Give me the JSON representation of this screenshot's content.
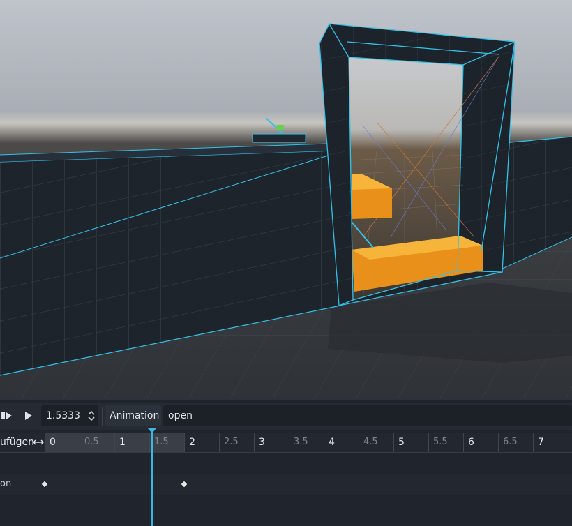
{
  "toolbar": {
    "play_from_start_icon": "play-from-start-icon",
    "play_icon": "play-icon",
    "time_value": "1.5333",
    "spin_icon": "spinner-arrows-icon",
    "animation_menu_label": "Animation",
    "animation_name": "open"
  },
  "timeline": {
    "add_track_label": "ufügen",
    "expand_icon": "horizontal-arrows-icon",
    "ticks": [
      {
        "label": "0",
        "kind": "major"
      },
      {
        "label": "0.5",
        "kind": "minor"
      },
      {
        "label": "1",
        "kind": "major"
      },
      {
        "label": "1.5",
        "kind": "minor"
      },
      {
        "label": "2",
        "kind": "major"
      },
      {
        "label": "2.5",
        "kind": "minor"
      },
      {
        "label": "3",
        "kind": "major"
      },
      {
        "label": "3.5",
        "kind": "minor"
      },
      {
        "label": "4",
        "kind": "major"
      },
      {
        "label": "4.5",
        "kind": "minor"
      },
      {
        "label": "5",
        "kind": "major"
      },
      {
        "label": "5.5",
        "kind": "minor"
      },
      {
        "label": "6",
        "kind": "major"
      },
      {
        "label": "6.5",
        "kind": "minor"
      },
      {
        "label": "7",
        "kind": "major"
      }
    ],
    "track_label": "on",
    "keyframe_times": [
      0,
      2
    ],
    "playhead_time": 1.5333
  },
  "colors": {
    "accent": "#3fb4e6",
    "wireframe": "#33c2e8",
    "door_orange": "#f3a11c"
  }
}
